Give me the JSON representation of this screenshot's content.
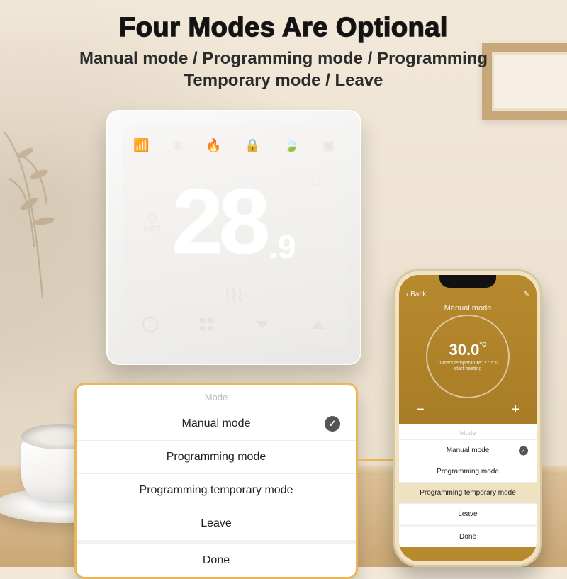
{
  "header": {
    "title": "Four Modes Are Optional",
    "subtitle_line1": "Manual mode / Programming mode / Programming",
    "subtitle_line2": "Temporary mode / Leave"
  },
  "thermostat": {
    "top_icons": [
      "wifi-icon",
      "target-icon",
      "flame-icon",
      "lock-icon",
      "leaf-icon",
      "window-icon"
    ],
    "set_label": "SET",
    "temp_int": "28",
    "temp_dec": ".9",
    "unit": "°C",
    "heating_icon": "heat-waves-icon",
    "bottom_icons": [
      "power-icon",
      "modes-icon",
      "down-icon",
      "up-icon"
    ]
  },
  "modes_popup": {
    "header": "Mode",
    "items": [
      {
        "label": "Manual mode",
        "selected": true
      },
      {
        "label": "Programming mode",
        "selected": false
      },
      {
        "label": "Programming temporary mode",
        "selected": false
      },
      {
        "label": "Leave",
        "selected": false
      }
    ],
    "done": "Done"
  },
  "phone": {
    "nav_back": "‹ Back",
    "nav_edit": "✎",
    "mode_label": "Manual mode",
    "dial_temp": "30.0",
    "dial_unit": "°C",
    "dial_sub1": "Current temperature: 27.5°C",
    "dial_sub2": "start heating",
    "minus": "−",
    "plus": "+",
    "list_header": "Mode",
    "list": [
      {
        "label": "Manual mode",
        "selected": true,
        "hl": false
      },
      {
        "label": "Programming mode",
        "selected": false,
        "hl": false
      },
      {
        "label": "Programming temporary mode",
        "selected": false,
        "hl": true
      },
      {
        "label": "Leave",
        "selected": false,
        "hl": false
      }
    ],
    "done": "Done"
  }
}
